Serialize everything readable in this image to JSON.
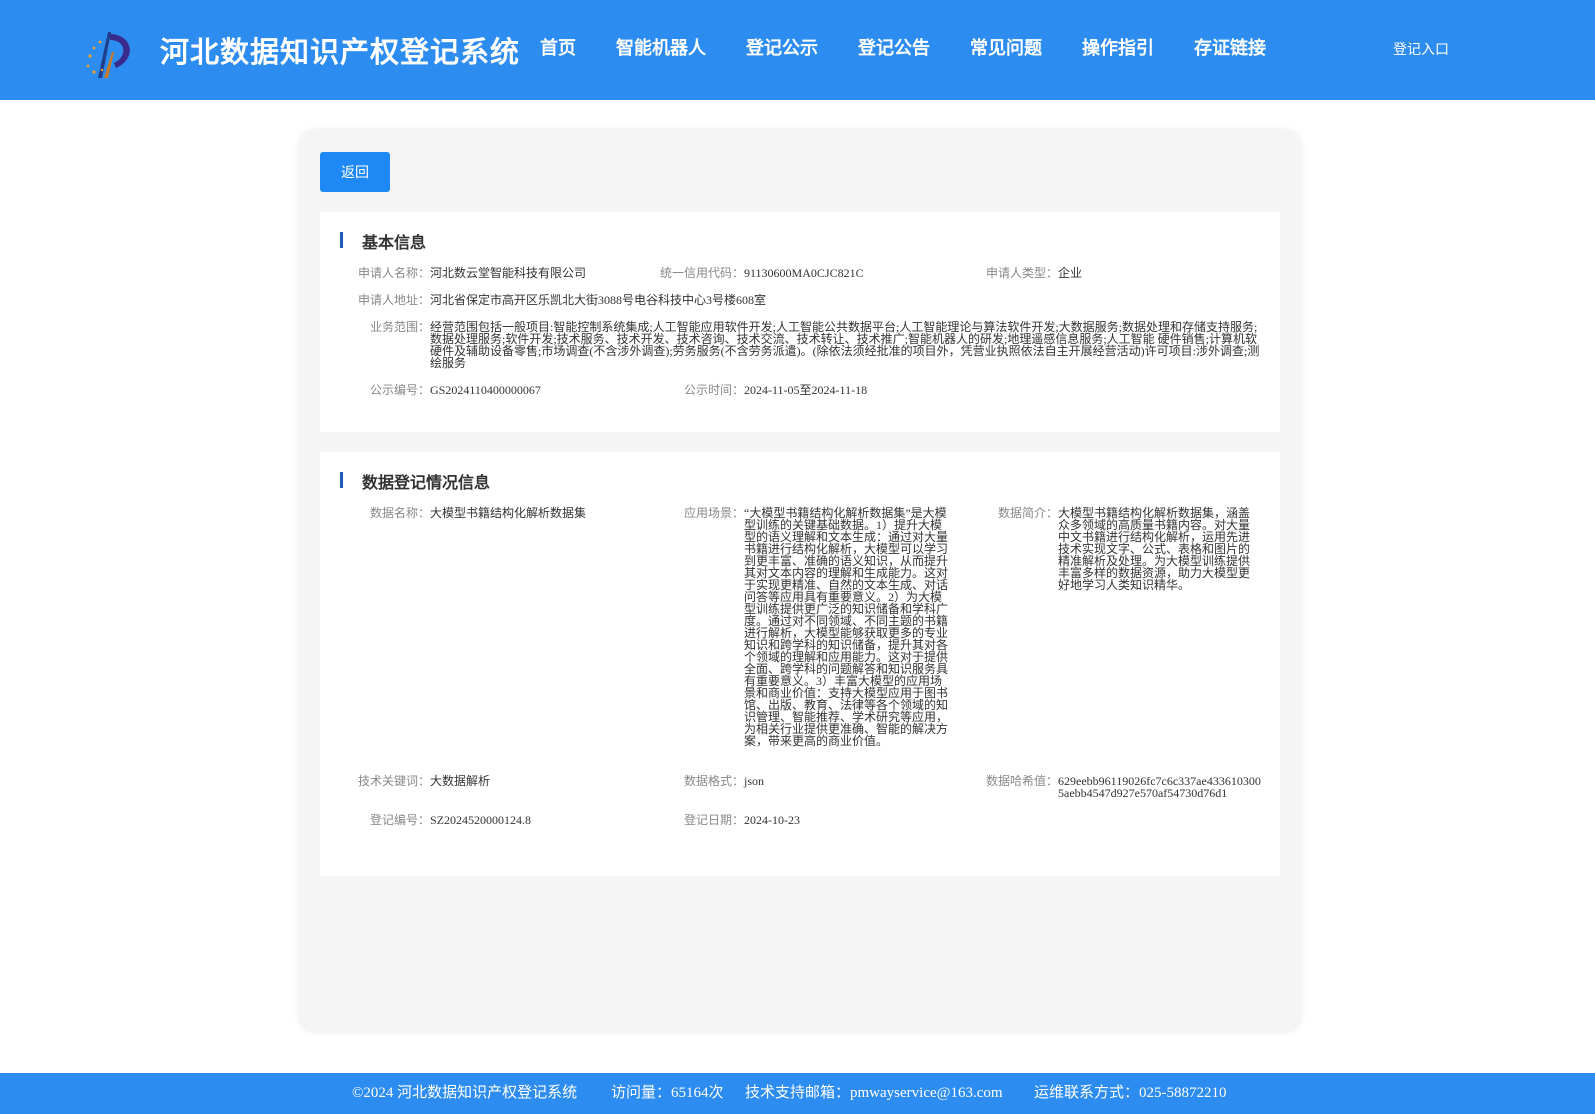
{
  "header": {
    "title": "河北数据知识产权登记系统",
    "nav": [
      "首页",
      "智能机器人",
      "登记公示",
      "登记公告",
      "常见问题",
      "操作指引",
      "存证链接"
    ],
    "login": "登记入口"
  },
  "back_button": "返回",
  "basic_info": {
    "title": "基本信息",
    "applicant_name_label": "申请人名称：",
    "applicant_name": "河北数云堂智能科技有限公司",
    "credit_code_label": "统一信用代码：",
    "credit_code": "91130600MA0CJC821C",
    "applicant_type_label": "申请人类型：",
    "applicant_type": "企业",
    "address_label": "申请人地址：",
    "address": "河北省保定市高开区乐凯北大街3088号电谷科技中心3号楼608室",
    "scope_label": "业务范围：",
    "scope": "经营范围包括一般项目:智能控制系统集成;人工智能应用软件开发;人工智能公共数据平台;人工智能理论与算法软件开发;大数据服务;数据处理和存储支持服务;数据处理服务;软件开发;技术服务、技术开发、技术咨询、技术交流、技术转让、技术推广;智能机器人的研发;地理遥感信息服务;人工智能 硬件销售;计算机软硬件及辅助设备零售;市场调查(不含涉外调查);劳务服务(不含劳务派遣)。(除依法须经批准的项目外，凭营业执照依法自主开展经营活动)许可项目:涉外调查;测绘服务",
    "pub_no_label": "公示编号：",
    "pub_no": "GS2024110400000067",
    "pub_time_label": "公示时间：",
    "pub_time": "2024-11-05至2024-11-18"
  },
  "data_info": {
    "title": "数据登记情况信息",
    "data_name_label": "数据名称：",
    "data_name": "大模型书籍结构化解析数据集",
    "scenario_label": "应用场景：",
    "scenario": "“大模型书籍结构化解析数据集”是大模型训练的关键基础数据。1）提升大模型的语义理解和文本生成：通过对大量书籍进行结构化解析，大模型可以学习到更丰富、准确的语义知识，从而提升其对文本内容的理解和生成能力。这对于实现更精准、自然的文本生成、对话问答等应用具有重要意义。2）为大模型训练提供更广泛的知识储备和学科广度。通过对不同领域、不同主题的书籍进行解析，大模型能够获取更多的专业知识和跨学科的知识储备，提升其对各个领域的理解和应用能力。这对于提供全面、跨学科的问题解答和知识服务具有重要意义。3）丰富大模型的应用场景和商业价值：支持大模型应用于图书馆、出版、教育、法律等各个领域的知识管理、智能推荐、学术研究等应用，为相关行业提供更准确、智能的解决方案，带来更高的商业价值。",
    "intro_label": "数据简介：",
    "intro": "大模型书籍结构化解析数据集，涵盖众多领域的高质量书籍内容。对大量中文书籍进行结构化解析，运用先进技术实现文字、公式、表格和图片的精准解析及处理。为大模型训练提供丰富多样的数据资源，助力大模型更好地学习人类知识精华。",
    "keyword_label": "技术关键词：",
    "keyword": "大数据解析",
    "format_label": "数据格式：",
    "format": "json",
    "hash_label": "数据哈希值：",
    "hash": "629eebb96119026fc7c6c337ae4336103005aebb4547d927e570af54730d76d1",
    "reg_no_label": "登记编号：",
    "reg_no": "SZ2024520000124.8",
    "reg_date_label": "登记日期：",
    "reg_date": "2024-10-23"
  },
  "footer": {
    "copyright": "©2024 河北数据知识产权登记系统",
    "visits": "访问量：65164次",
    "email": "技术支持邮箱：pmwayservice@163.com",
    "phone": "运维联系方式：025-58872210"
  },
  "colors": {
    "primary": "#2d8cf0",
    "button": "#1e88f5",
    "accent_bar": "#1a5fb4"
  }
}
